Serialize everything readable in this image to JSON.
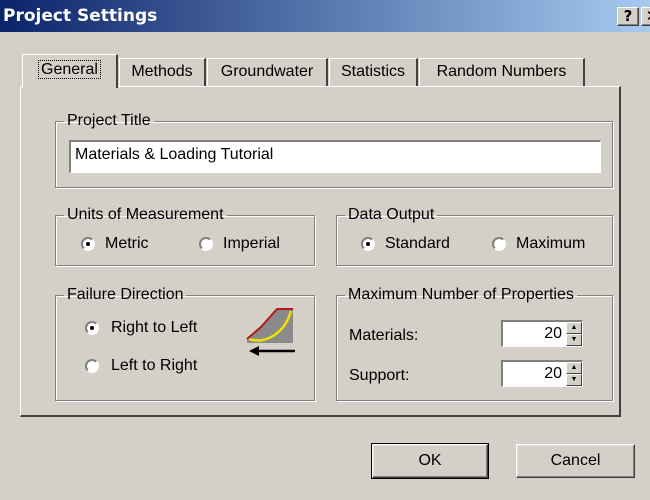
{
  "window": {
    "title": "Project Settings",
    "help_glyph": "?",
    "close_glyph": "✕"
  },
  "tabs": [
    "General",
    "Methods",
    "Groundwater",
    "Statistics",
    "Random Numbers"
  ],
  "project_title": {
    "legend": "Project Title",
    "value": "Materials & Loading Tutorial"
  },
  "units": {
    "legend": "Units of Measurement",
    "options": [
      "Metric",
      "Imperial"
    ],
    "selected": "Metric"
  },
  "data_output": {
    "legend": "Data Output",
    "options": [
      "Standard",
      "Maximum"
    ],
    "selected": "Standard"
  },
  "failure_direction": {
    "legend": "Failure Direction",
    "options": [
      "Right to Left",
      "Left to Right"
    ],
    "selected": "Right to Left",
    "icon": "slope-failure-icon"
  },
  "max_properties": {
    "legend": "Maximum Number of Properties",
    "materials_label": "Materials:",
    "materials_value": "20",
    "support_label": "Support:",
    "support_value": "20"
  },
  "buttons": {
    "ok": "OK",
    "cancel": "Cancel"
  },
  "colors": {
    "title_start": "#0a246a",
    "title_end": "#a6caf0",
    "face": "#d4d0c8",
    "slope_fill": "#8a8a8a",
    "slip_surface": "#f0e000",
    "slope_line": "#b01818"
  }
}
